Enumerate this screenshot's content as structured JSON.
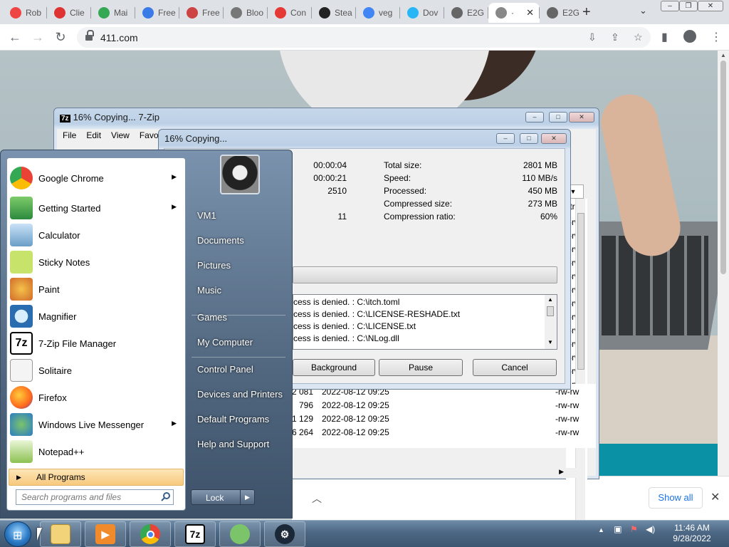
{
  "browser": {
    "tabs": [
      {
        "label": "Rob",
        "color": "#e44"
      },
      {
        "label": "Clie",
        "color": "#d33"
      },
      {
        "label": "Mai",
        "color": "#34a853"
      },
      {
        "label": "Free",
        "color": "#3b7be8"
      },
      {
        "label": "Free",
        "color": "#c44"
      },
      {
        "label": "Bloo",
        "color": "#777"
      },
      {
        "label": "Con",
        "color": "#e53935"
      },
      {
        "label": "Stea",
        "color": "#222"
      },
      {
        "label": "veg",
        "color": "#4285f4"
      },
      {
        "label": "Dov",
        "color": "#29b6f6"
      },
      {
        "label": "E2G",
        "color": "#666"
      },
      {
        "label": "·",
        "color": "#888"
      },
      {
        "label": "E2G",
        "color": "#666"
      }
    ],
    "active_tab_index": 11,
    "new_tab_symbol": "+",
    "url": "411.com",
    "show_all_label": "Show all"
  },
  "filemanager": {
    "title": "16% Copying... 7-Zip",
    "menus": [
      "File",
      "Edit",
      "View",
      "Favo"
    ],
    "rows": [
      {
        "size": "2 081",
        "date": "2022-08-12 09:25",
        "attr": "-rw-rw"
      },
      {
        "size": "796",
        "date": "2022-08-12 09:25",
        "attr": "-rw-rw"
      },
      {
        "size": "1 129",
        "date": "2022-08-12 09:25",
        "attr": "-rw-rw"
      },
      {
        "size": "6 264",
        "date": "2022-08-12 09:25",
        "attr": "-rw-rw"
      }
    ],
    "right_col_header": "ttrib",
    "right_col_rows": [
      "-rw",
      "-rw",
      "-rw",
      "-rw",
      "-rw",
      "-rw",
      "-rw",
      "-rw",
      "-rw",
      "-rw",
      "-rw",
      "-rw",
      "-rw"
    ]
  },
  "progress": {
    "title": "16% Copying...",
    "left_values": [
      "00:00:04",
      "00:00:21",
      "2510",
      "11"
    ],
    "stats": [
      {
        "label": "Total size:",
        "value": "2801 MB"
      },
      {
        "label": "Speed:",
        "value": "110 MB/s"
      },
      {
        "label": "Processed:",
        "value": "450 MB"
      },
      {
        "label": "Compressed size:",
        "value": "273 MB"
      },
      {
        "label": "Compression ratio:",
        "value": "60%"
      }
    ],
    "percent": 16,
    "log": [
      "cess is denied. : C:\\itch.toml",
      "cess is denied. : C:\\LICENSE-RESHADE.txt",
      "cess is denied. : C:\\LICENSE.txt",
      "cess is denied. : C:\\NLog.dll"
    ],
    "buttons": {
      "background": "Background",
      "pause": "Pause",
      "cancel": "Cancel"
    }
  },
  "startmenu": {
    "programs": [
      {
        "label": "Google Chrome",
        "icon": "chrome-icon",
        "arrow": true
      },
      {
        "label": "Getting Started",
        "icon": "getting-started-icon",
        "arrow": true
      },
      {
        "label": "Calculator",
        "icon": "calculator-icon",
        "arrow": false
      },
      {
        "label": "Sticky Notes",
        "icon": "sticky-notes-icon",
        "arrow": false
      },
      {
        "label": "Paint",
        "icon": "paint-icon",
        "arrow": false
      },
      {
        "label": "Magnifier",
        "icon": "magnifier-icon",
        "arrow": false
      },
      {
        "label": "7-Zip File Manager",
        "icon": "7zip-icon",
        "arrow": false
      },
      {
        "label": "Solitaire",
        "icon": "solitaire-icon",
        "arrow": false
      },
      {
        "label": "Firefox",
        "icon": "firefox-icon",
        "arrow": false
      },
      {
        "label": "Windows Live Messenger",
        "icon": "messenger-icon",
        "arrow": true
      },
      {
        "label": "Notepad++",
        "icon": "notepadpp-icon",
        "arrow": false
      }
    ],
    "all_programs": "All Programs",
    "search_placeholder": "Search programs and files",
    "right": [
      "VM1",
      "Documents",
      "Pictures",
      "Music",
      "Games",
      "My Computer",
      "Control Panel",
      "Devices and Printers",
      "Default Programs",
      "Help and Support"
    ],
    "lock_label": "Lock"
  },
  "taskbar": {
    "apps": [
      "explorer-icon",
      "media-player-icon",
      "chrome-icon",
      "7zip-icon",
      "messenger-icon",
      "steam-icon"
    ],
    "time": "11:46 AM",
    "date": "9/28/2022"
  }
}
